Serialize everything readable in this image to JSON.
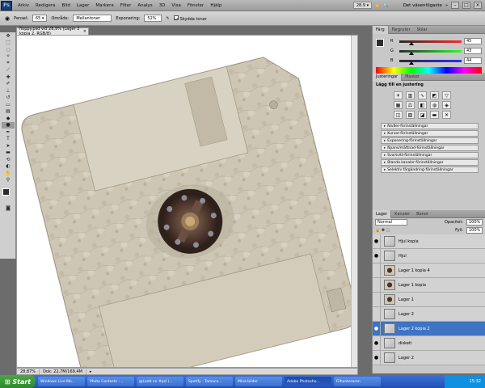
{
  "menubar": {
    "app_icon": "Ps",
    "items": [
      "Arkiv",
      "Redigera",
      "Bild",
      "Lager",
      "Markera",
      "Filter",
      "Analys",
      "3D",
      "Visa",
      "Fönster",
      "Hjälp"
    ],
    "zoom": "28,9",
    "workspace": "Det väsentligaste"
  },
  "options": {
    "brush_size": "65",
    "range_label": "Område:",
    "range_value": "Mellantoner",
    "exposure_label": "Exponering:",
    "exposure_value": "52%",
    "protect_tones": "Skydda toner"
  },
  "document": {
    "tab_title": "floppy.psd vid 28,9% (Lager 2 kopia 2, RGB/8)",
    "zoom_status": "28,87%",
    "doc_status": "Dok: 22,7M/169,4M"
  },
  "color_panel": {
    "tabs": [
      "Färg",
      "Färgrutor",
      "Stilar"
    ],
    "channels": [
      {
        "label": "R",
        "value": "45"
      },
      {
        "label": "G",
        "value": "43"
      },
      {
        "label": "B",
        "value": "44"
      }
    ]
  },
  "adjust_panel": {
    "tabs": [
      "Justeringar",
      "Masker"
    ],
    "heading": "Lägg till en justering",
    "presets": [
      "Nivåer-förinställningar",
      "Kurvor-förinställningar",
      "Exponering-förinställningar",
      "Nyans/mättnad-förinställningar",
      "Svartvitt-förinställningar",
      "Blanda kanaler-förinställningar",
      "Selektiv färgändring-förinställningar"
    ]
  },
  "layers_panel": {
    "tabs": [
      "Lager",
      "Kanaler",
      "Banor"
    ],
    "blend_mode": "Normal",
    "opacity_label": "Opacitet:",
    "opacity_value": "100%",
    "fill_label": "Fyll:",
    "fill_value": "100%",
    "layers": [
      {
        "name": "Hjul kopia",
        "visible": true,
        "thumb": "plain",
        "selected": false
      },
      {
        "name": "Hjul",
        "visible": true,
        "thumb": "plain",
        "selected": false
      },
      {
        "name": "Lager 1 kopia 4",
        "visible": false,
        "thumb": "disk",
        "selected": false
      },
      {
        "name": "Lager 1 kopia",
        "visible": false,
        "thumb": "disk",
        "selected": false
      },
      {
        "name": "Lager 1",
        "visible": false,
        "thumb": "disk",
        "selected": false
      },
      {
        "name": "Lager 2",
        "visible": false,
        "thumb": "plain",
        "selected": false
      },
      {
        "name": "Lager 2 kopia 2",
        "visible": true,
        "thumb": "plain",
        "selected": true
      },
      {
        "name": "disketi",
        "visible": true,
        "thumb": "plain",
        "selected": false
      },
      {
        "name": "Lager 2",
        "visible": true,
        "thumb": "plain",
        "selected": false
      }
    ]
  },
  "taskbar": {
    "start": "Start",
    "tasks": [
      "Windows Live Me...",
      "Photo Contests -...",
      "@Ladd on #psl (...",
      "Spotify - Tamaco...",
      "Mina bilder",
      "Adobe Photosho...",
      "Filhanteraren"
    ],
    "active_task": 5,
    "clock": "15:32"
  },
  "colors": {
    "accent": "#3f73c4",
    "panel": "#c8c8c8",
    "taskbar": "#245edc"
  }
}
